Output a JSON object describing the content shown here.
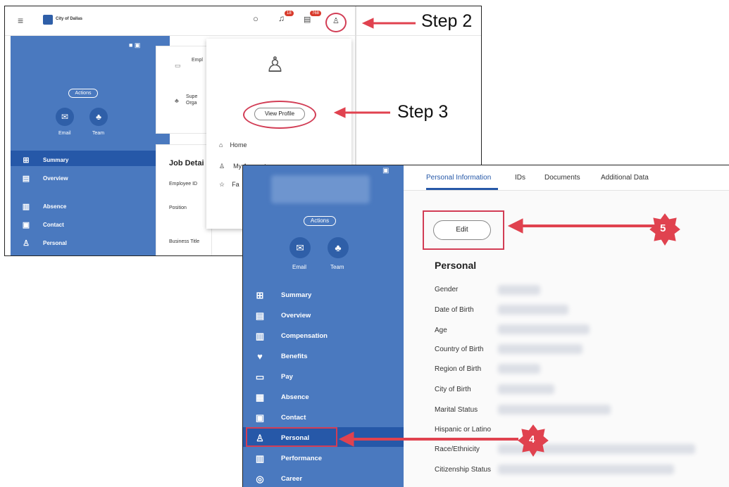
{
  "annotations": {
    "step2": "Step 2",
    "step3": "Step 3",
    "step4": "4",
    "step5": "5",
    "arrow_color": "#e0424f"
  },
  "shot1": {
    "brand": "City of Dallas",
    "notifications_count": "18",
    "inbox_count": "768",
    "actions_label": "Actions",
    "email_label": "Email",
    "team_label": "Team",
    "nav": [
      {
        "label": "Summary",
        "icon": "grid-icon"
      },
      {
        "label": "Overview",
        "icon": "document-icon"
      },
      {
        "label": "Absence",
        "icon": "clipboard-icon"
      },
      {
        "label": "Contact",
        "icon": "contact-card-icon"
      },
      {
        "label": "Personal",
        "icon": "person-icon"
      }
    ],
    "card_items": [
      "Empl",
      "Supe",
      "Orga"
    ],
    "job_details_title": "Job Detai",
    "job_fields": [
      "Employee ID",
      "Position",
      "Business Title"
    ],
    "menu": {
      "view_profile": "View Profile",
      "home": "Home",
      "my_account": "My Account",
      "favorites": "Fa"
    }
  },
  "shot2": {
    "actions_label": "Actions",
    "email_label": "Email",
    "team_label": "Team",
    "nav": [
      {
        "label": "Summary",
        "icon": "grid-icon"
      },
      {
        "label": "Overview",
        "icon": "document-icon"
      },
      {
        "label": "Compensation",
        "icon": "chart-icon"
      },
      {
        "label": "Benefits",
        "icon": "shield-icon"
      },
      {
        "label": "Pay",
        "icon": "wallet-icon"
      },
      {
        "label": "Absence",
        "icon": "clipboard-icon"
      },
      {
        "label": "Contact",
        "icon": "contact-card-icon"
      },
      {
        "label": "Personal",
        "icon": "person-icon"
      },
      {
        "label": "Performance",
        "icon": "chart-icon"
      },
      {
        "label": "Career",
        "icon": "target-icon"
      }
    ],
    "tabs": [
      "Personal Information",
      "IDs",
      "Documents",
      "Additional Data"
    ],
    "edit_label": "Edit",
    "section_title": "Personal",
    "fields": [
      "Gender",
      "Date of Birth",
      "Age",
      "Country of Birth",
      "Region of Birth",
      "City of Birth",
      "Marital Status",
      "Hispanic or Latino",
      "Race/Ethnicity",
      "Citizenship Status"
    ]
  }
}
